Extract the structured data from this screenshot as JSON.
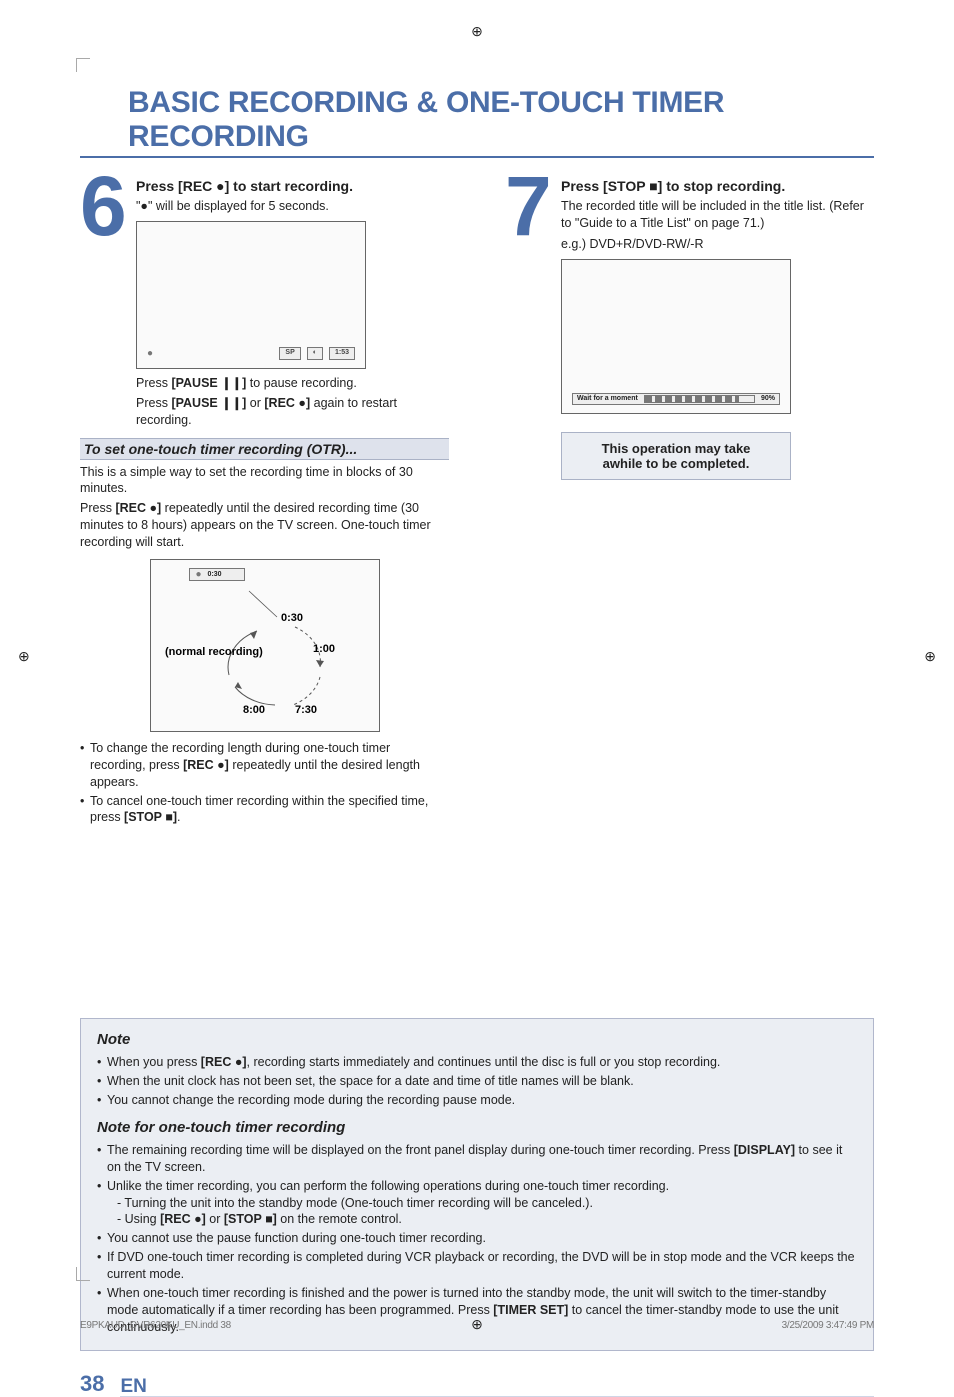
{
  "title": "BASIC RECORDING & ONE-TOUCH TIMER RECORDING",
  "steps": [
    {
      "num": "6",
      "heading_pre": "Press ",
      "heading_btn": "[REC ●]",
      "heading_post": " to start recording.",
      "sub": "\"●\" will be displayed for 5 seconds.",
      "osd_sp": "SP",
      "osd_time": "1:53",
      "pause_text_pre": "Press ",
      "pause_btn": "[PAUSE ❙❙]",
      "pause_text_mid": " to pause recording.",
      "restart_pre": "Press ",
      "restart_b1": "[PAUSE ❙❙]",
      "restart_or": " or ",
      "restart_b2": "[REC ●]",
      "restart_post": " again to restart recording."
    },
    {
      "num": "7",
      "heading_pre": "Press ",
      "heading_btn": "[STOP ■]",
      "heading_post": " to stop recording.",
      "line1": "The recorded title will be included in the title list. (Refer to \"Guide to a Title List\" on page 71.)",
      "eg": "e.g.) DVD+R/DVD-RW/-R",
      "wait": "Wait for a moment",
      "pct": "90%",
      "callout_l1": "This operation may take",
      "callout_l2": "awhile to be completed."
    }
  ],
  "otr": {
    "header": "To set one-touch timer recording (OTR)...",
    "p1": "This is a simple way to set the recording time in blocks of 30 minutes.",
    "p2_pre": "Press ",
    "p2_btn": "[REC ●]",
    "p2_post": " repeatedly until the desired recording time (30 minutes to 8 hours) appears on the TV screen. One-touch timer recording will start.",
    "strip_time": "0:30",
    "labels": {
      "top": "0:30",
      "normal": "(normal recording)",
      "one": "1:00",
      "eight": "8:00",
      "seven30": "7:30"
    },
    "bullets": [
      {
        "pre": "To change the recording length during one-touch timer recording, press ",
        "btn": "[REC ●]",
        "post": " repeatedly until the desired length appears."
      },
      {
        "pre": "To cancel one-touch timer recording within the specified time, press ",
        "btn": "[STOP ■]",
        "post": "."
      }
    ]
  },
  "notes": {
    "h1": "Note",
    "items1": [
      {
        "pre": "When you press ",
        "btn": "[REC ●]",
        "post": ", recording starts immediately and continues until the disc is full or you stop recording."
      },
      {
        "text": "When the unit clock has not been set, the space for a date and time of title names will be blank."
      },
      {
        "text": "You cannot change the recording mode during the recording pause mode."
      }
    ],
    "h2": "Note for one-touch timer recording",
    "items2": [
      {
        "pre": "The remaining recording time will be displayed on the front panel display during one-touch timer recording. Press ",
        "btn": "[DISPLAY]",
        "post": " to see it on the TV screen."
      },
      {
        "text": "Unlike the timer recording, you can perform the following operations during one-touch timer recording.",
        "sub": [
          "- Turning the unit into the standby mode (One-touch timer recording will be canceled.).",
          {
            "pre": "- Using ",
            "b1": "[REC ●]",
            "mid": " or ",
            "b2": "[STOP ■]",
            "post": " on the remote control."
          }
        ]
      },
      {
        "text": "You cannot use the pause function during one-touch timer recording."
      },
      {
        "text": "If DVD one-touch timer recording is completed during VCR playback or recording, the DVD will be in stop mode and the VCR keeps the current mode."
      },
      {
        "pre": "When one-touch timer recording is finished and the power is turned into the standby mode, the unit will switch to the timer-standby mode automatically if a timer recording has been programmed. Press ",
        "btn": "[TIMER SET]",
        "post": " to cancel the timer-standby mode to use the unit continuously."
      }
    ]
  },
  "footer": {
    "page": "38",
    "lang": "EN"
  },
  "printfoot": {
    "left": "E9PKAUD_DVR620KU_EN.indd   38",
    "right": "3/25/2009   3:47:49 PM"
  }
}
